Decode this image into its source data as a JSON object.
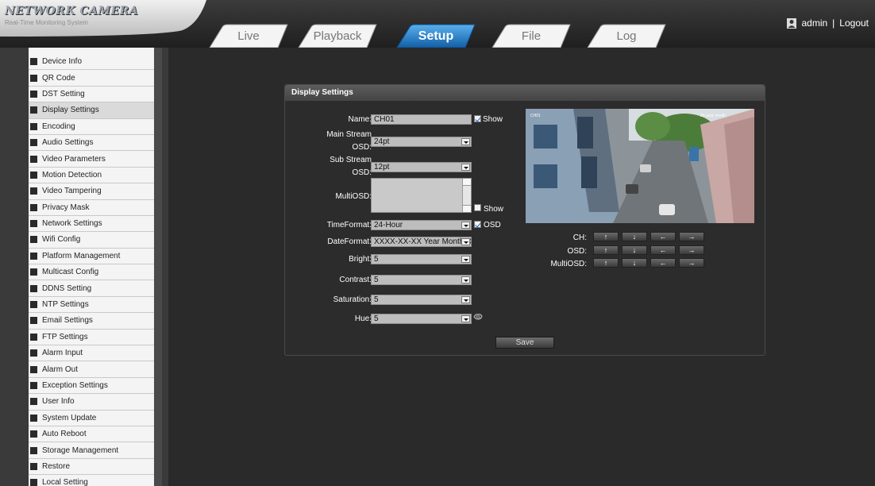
{
  "header": {
    "logo_title": "NETWORK CAMERA",
    "logo_subtitle": "Real-Time Monitoring System",
    "tabs": [
      {
        "label": "Live",
        "active": false
      },
      {
        "label": "Playback",
        "active": false
      },
      {
        "label": "Setup",
        "active": true
      },
      {
        "label": "File",
        "active": false
      },
      {
        "label": "Log",
        "active": false
      }
    ],
    "user": "admin",
    "separator": "|",
    "logout": "Logout"
  },
  "sidebar": {
    "items": [
      {
        "label": "Device Info"
      },
      {
        "label": "QR Code"
      },
      {
        "label": "DST Setting"
      },
      {
        "label": "Display Settings",
        "active": true
      },
      {
        "label": "Encoding"
      },
      {
        "label": "Audio Settings"
      },
      {
        "label": "Video Parameters"
      },
      {
        "label": "Motion Detection"
      },
      {
        "label": "Video Tampering"
      },
      {
        "label": "Privacy Mask"
      },
      {
        "label": "Network Settings"
      },
      {
        "label": "Wifi Config"
      },
      {
        "label": "Platform Management"
      },
      {
        "label": "Multicast Config"
      },
      {
        "label": "DDNS Setting"
      },
      {
        "label": "NTP Settings"
      },
      {
        "label": "Email Settings"
      },
      {
        "label": "FTP Settings"
      },
      {
        "label": "Alarm Input"
      },
      {
        "label": "Alarm Out"
      },
      {
        "label": "Exception Settings"
      },
      {
        "label": "User Info"
      },
      {
        "label": "System Update"
      },
      {
        "label": "Auto Reboot"
      },
      {
        "label": "Storage Management"
      },
      {
        "label": "Restore"
      },
      {
        "label": "Local Setting"
      }
    ]
  },
  "panel": {
    "title": "Display Settings",
    "name_label": "Name:",
    "name_value": "CH01",
    "show_label": "Show",
    "main_stream_label_1": "Main Stream",
    "main_stream_label_2": "OSD:",
    "main_stream_value": "24pt",
    "sub_stream_label_1": "Sub Stream",
    "sub_stream_label_2": "OSD:",
    "sub_stream_value": "12pt",
    "multiosd_label": "MultiOSD:",
    "multiosd_show_label": "Show",
    "timeformat_label": "TimeFormat:",
    "timeformat_value": "24-Hour",
    "osd_label": "OSD",
    "dateformat_label": "DateFormat:",
    "dateformat_value": "XXXX-XX-XX Year Month Day",
    "bright_label": "Bright:",
    "bright_value": "5",
    "contrast_label": "Contrast:",
    "contrast_value": "5",
    "saturation_label": "Saturation:",
    "saturation_value": "5",
    "hue_label": "Hue:",
    "hue_value": "5",
    "save_label": "Save"
  },
  "controls": {
    "ch_label": "CH:",
    "osd_label": "OSD:",
    "multiosd_label": "MultiOSD:",
    "arrows": [
      "↑",
      "↓",
      "←",
      "→"
    ]
  },
  "colors": {
    "active_tab": "#1a78c2",
    "background": "#2a2a2a",
    "menu_bg": "#f4f4f4"
  }
}
